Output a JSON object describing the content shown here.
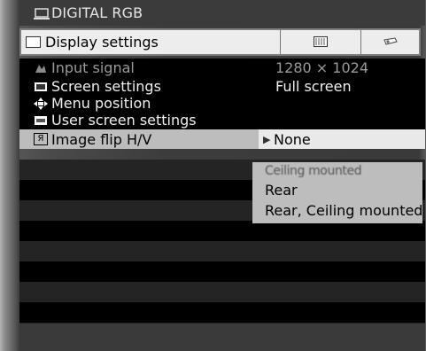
{
  "window": {
    "title": "DIGITAL RGB",
    "title_icon": "monitor-icon"
  },
  "tab_bar": {
    "active_tab_label": "Display settings",
    "tab_icons": [
      "panel-icon",
      "projector-icon"
    ]
  },
  "menu": {
    "items": [
      {
        "label": "Input signal",
        "value": "1280 × 1024",
        "icon": "input-signal-icon",
        "state": "disabled"
      },
      {
        "label": "Screen settings",
        "value": "Full screen",
        "icon": "screen-settings-icon",
        "state": "normal"
      },
      {
        "label": "Menu position",
        "value": "",
        "icon": "menu-position-icon",
        "state": "normal"
      },
      {
        "label": "User screen settings",
        "value": "",
        "icon": "user-screen-icon",
        "state": "normal"
      },
      {
        "label": "Image flip H/V",
        "value": "None",
        "icon": "image-flip-icon",
        "state": "selected"
      }
    ]
  },
  "dropdown": {
    "options": [
      "Ceiling mounted",
      "Rear",
      "Rear, Ceiling mounted"
    ]
  },
  "colors": {
    "background": "#3b3b3b",
    "menu_background": "#000000",
    "highlight": "#bdbdbd",
    "text": "#f0f0f0"
  }
}
